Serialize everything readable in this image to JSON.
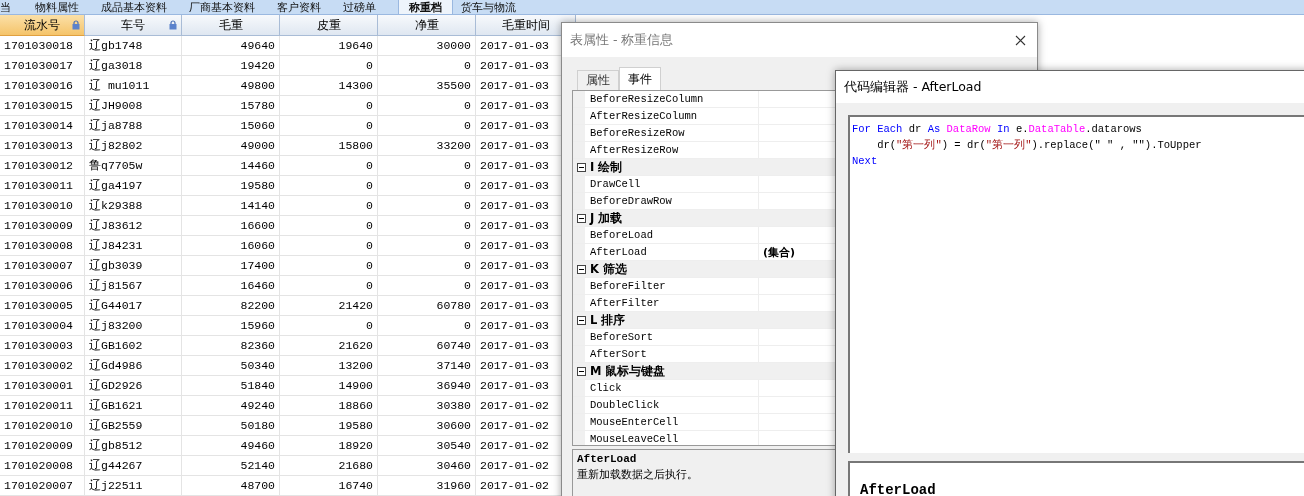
{
  "app_tabs": [
    {
      "label": "当",
      "selected": false
    },
    {
      "label": "物料属性",
      "selected": false
    },
    {
      "label": "成品基本资料",
      "selected": false
    },
    {
      "label": "厂商基本资料",
      "selected": false
    },
    {
      "label": "客户资料",
      "selected": false
    },
    {
      "label": "过磅单",
      "selected": false
    },
    {
      "label": "称重档",
      "selected": true
    },
    {
      "label": "货车与物流",
      "selected": false
    }
  ],
  "grid": {
    "columns": [
      {
        "label": "流水号",
        "selected": true,
        "locked": true
      },
      {
        "label": "车号",
        "selected": false,
        "locked": true
      },
      {
        "label": "毛重",
        "selected": false,
        "locked": false
      },
      {
        "label": "皮重",
        "selected": false,
        "locked": false
      },
      {
        "label": "净重",
        "selected": false,
        "locked": false
      },
      {
        "label": "毛重时间",
        "selected": false,
        "locked": false
      }
    ],
    "rows": [
      [
        "1701030018",
        "辽gb1748",
        "49640",
        "19640",
        "30000",
        "2017-01-03"
      ],
      [
        "1701030017",
        "辽ga3018",
        "19420",
        "0",
        "0",
        "2017-01-03"
      ],
      [
        "1701030016",
        "辽 mu1011",
        "49800",
        "14300",
        "35500",
        "2017-01-03"
      ],
      [
        "1701030015",
        "辽JH9008",
        "15780",
        "0",
        "0",
        "2017-01-03"
      ],
      [
        "1701030014",
        "辽ja8788",
        "15060",
        "0",
        "0",
        "2017-01-03"
      ],
      [
        "1701030013",
        "辽j82802",
        "49000",
        "15800",
        "33200",
        "2017-01-03"
      ],
      [
        "1701030012",
        "鲁q7705w",
        "14460",
        "0",
        "0",
        "2017-01-03"
      ],
      [
        "1701030011",
        "辽ga4197",
        "19580",
        "0",
        "0",
        "2017-01-03"
      ],
      [
        "1701030010",
        "辽k29388",
        "14140",
        "0",
        "0",
        "2017-01-03"
      ],
      [
        "1701030009",
        "辽J83612",
        "16600",
        "0",
        "0",
        "2017-01-03"
      ],
      [
        "1701030008",
        "辽J84231",
        "16060",
        "0",
        "0",
        "2017-01-03"
      ],
      [
        "1701030007",
        "辽gb3039",
        "17400",
        "0",
        "0",
        "2017-01-03"
      ],
      [
        "1701030006",
        "辽j81567",
        "16460",
        "0",
        "0",
        "2017-01-03"
      ],
      [
        "1701030005",
        "辽G44017",
        "82200",
        "21420",
        "60780",
        "2017-01-03"
      ],
      [
        "1701030004",
        "辽j83200",
        "15960",
        "0",
        "0",
        "2017-01-03"
      ],
      [
        "1701030003",
        "辽GB1602",
        "82360",
        "21620",
        "60740",
        "2017-01-03"
      ],
      [
        "1701030002",
        "辽Gd4986",
        "50340",
        "13200",
        "37140",
        "2017-01-03"
      ],
      [
        "1701030001",
        "辽GD2926",
        "51840",
        "14900",
        "36940",
        "2017-01-03"
      ],
      [
        "1701020011",
        "辽GB1621",
        "49240",
        "18860",
        "30380",
        "2017-01-02"
      ],
      [
        "1701020010",
        "辽GB2559",
        "50180",
        "19580",
        "30600",
        "2017-01-02"
      ],
      [
        "1701020009",
        "辽gb8512",
        "49460",
        "18920",
        "30540",
        "2017-01-02"
      ],
      [
        "1701020008",
        "辽g44267",
        "52140",
        "21680",
        "30460",
        "2017-01-02"
      ],
      [
        "1701020007",
        "辽j22511",
        "48700",
        "16740",
        "31960",
        "2017-01-02"
      ]
    ]
  },
  "properties_dialog": {
    "title": "表属性 - 称重信息",
    "tabs": [
      {
        "label": "属性",
        "selected": false
      },
      {
        "label": "事件",
        "selected": true
      }
    ],
    "events": [
      {
        "kind": "item",
        "name": "BeforeResizeColumn"
      },
      {
        "kind": "item",
        "name": "AfterResizeColumn"
      },
      {
        "kind": "item",
        "name": "BeforeResizeRow"
      },
      {
        "kind": "item",
        "name": "AfterResizeRow"
      },
      {
        "kind": "category",
        "name": "I 绘制",
        "expanded": true
      },
      {
        "kind": "item",
        "name": "DrawCell"
      },
      {
        "kind": "item",
        "name": "BeforeDrawRow"
      },
      {
        "kind": "category",
        "name": "J 加载",
        "expanded": true
      },
      {
        "kind": "item",
        "name": "BeforeLoad"
      },
      {
        "kind": "item",
        "name": "AfterLoad",
        "value": "(集合)"
      },
      {
        "kind": "category",
        "name": "K 筛选",
        "expanded": true
      },
      {
        "kind": "item",
        "name": "BeforeFilter"
      },
      {
        "kind": "item",
        "name": "AfterFilter"
      },
      {
        "kind": "category",
        "name": "L 排序",
        "expanded": true
      },
      {
        "kind": "item",
        "name": "BeforeSort"
      },
      {
        "kind": "item",
        "name": "AfterSort"
      },
      {
        "kind": "category",
        "name": "M 鼠标与键盘",
        "expanded": true
      },
      {
        "kind": "item",
        "name": "Click"
      },
      {
        "kind": "item",
        "name": "DoubleClick"
      },
      {
        "kind": "item",
        "name": "MouseEnterCell"
      },
      {
        "kind": "item",
        "name": "MouseLeaveCell"
      }
    ],
    "description": {
      "title": "AfterLoad",
      "text": "重新加载数据之后执行。"
    }
  },
  "code_editor": {
    "title": "代码编辑器 - AfterLoad",
    "lines": [
      [
        {
          "text": "For Each",
          "kind": "keyword"
        },
        {
          "text": " dr ",
          "kind": "plain"
        },
        {
          "text": "As",
          "kind": "keyword"
        },
        {
          "text": " DataRow",
          "kind": "type"
        },
        {
          "text": " In",
          "kind": "keyword"
        },
        {
          "text": " e.",
          "kind": "plain"
        },
        {
          "text": "DataTable",
          "kind": "type"
        },
        {
          "text": ".datarows",
          "kind": "plain"
        }
      ],
      [
        {
          "text": "    dr(",
          "kind": "plain"
        },
        {
          "text": "\"第一列\"",
          "kind": "string"
        },
        {
          "text": ") = dr(",
          "kind": "plain"
        },
        {
          "text": "\"第一列\"",
          "kind": "string"
        },
        {
          "text": ").replace(\" \" , \"\").ToUpper",
          "kind": "plain"
        }
      ],
      [
        {
          "text": "Next",
          "kind": "keyword"
        }
      ]
    ],
    "help_title": "AfterLoad"
  }
}
